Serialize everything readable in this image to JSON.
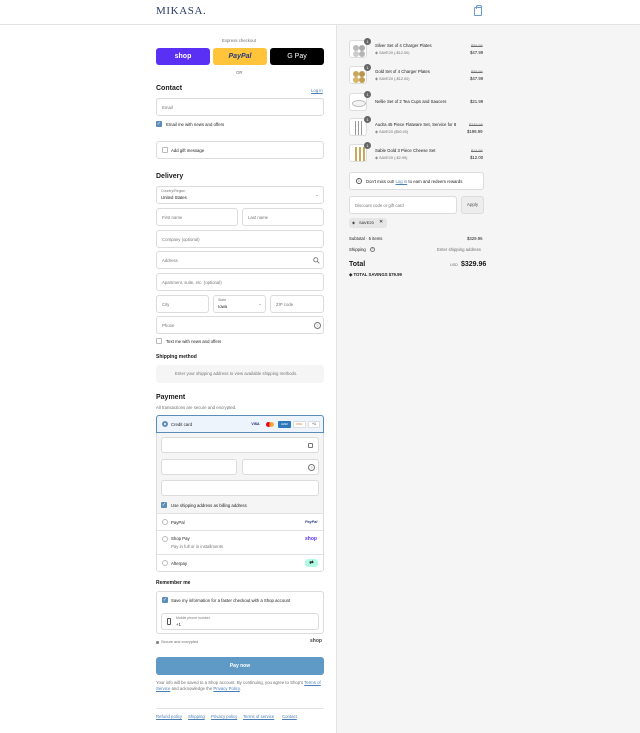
{
  "brand": {
    "logo": "MIKASA."
  },
  "express": {
    "title": "Express checkout",
    "shop": "shop",
    "paypal": "PayPal",
    "gpay": "G Pay",
    "or": "OR"
  },
  "contact": {
    "title": "Contact",
    "login": "Log in",
    "email_ph": "Email",
    "news_label": "Email me with news and offers",
    "gift_label": "Add gift message"
  },
  "delivery": {
    "title": "Delivery",
    "country_label": "Country/Region",
    "country_value": "United States",
    "first_ph": "First name",
    "last_ph": "Last name",
    "company_ph": "Company (optional)",
    "address_ph": "Address",
    "apt_ph": "Apartment, suite, etc. (optional)",
    "city_ph": "City",
    "state_label": "State",
    "state_value": "Iowa",
    "zip_ph": "ZIP code",
    "phone_ph": "Phone",
    "text_label": "Text me with news and offers"
  },
  "shipping": {
    "title": "Shipping method",
    "note": "Enter your shipping address to view available shipping methods."
  },
  "payment": {
    "title": "Payment",
    "subtitle": "All transactions are secure and encrypted.",
    "credit_card": "Credit card",
    "more_cards": "+1",
    "card_brands": [
      "VISA",
      "MC",
      "AMEX",
      "DISC"
    ],
    "billing_label": "Use shipping address as billing address",
    "paypal": "PayPal",
    "paypal_logo": "PayPal",
    "shoppay": "Shop Pay",
    "shoppay_sub": "Pay in full or in installments",
    "shoppay_logo": "shop",
    "afterpay": "Afterpay"
  },
  "remember": {
    "title": "Remember me",
    "save_label": "Save my information for a faster checkout with a Shop account",
    "phone_label": "Mobile phone number",
    "phone_value": "+1",
    "secure": "Secure and encrypted",
    "shop_logo": "shop"
  },
  "pay_button": "Pay now",
  "legal": {
    "text1": "Your info will be saved to a Shop account. By continuing, you agree to Shop's",
    "tos": "Terms of Service",
    "text2": "and acknowledge the",
    "privacy": "Privacy Policy",
    "period": "."
  },
  "footer": [
    "Refund policy",
    "Shipping",
    "Privacy policy",
    "Terms of service",
    "Contact"
  ],
  "items": [
    {
      "name": "Silver Set of 4 Charger Plates",
      "discount": "SAVE20 (-$12.00)",
      "old": "$59.99",
      "price": "$47.99",
      "qty": "1"
    },
    {
      "name": "Gold Set of 4 Charger Plates",
      "discount": "SAVE20 (-$12.00)",
      "old": "$59.99",
      "price": "$47.99",
      "qty": "1"
    },
    {
      "name": "Nellie Set of 2 Tea Cups and Saucers",
      "discount": "",
      "old": "",
      "price": "$21.99",
      "qty": "1"
    },
    {
      "name": "Audra 45 Piece Flatware Set, Service for 8",
      "discount": "SAVE20 ($50.00)",
      "old": "$249.99",
      "price": "$199.99",
      "qty": "1"
    },
    {
      "name": "Sable Gold 3 Piece Cheese Set",
      "discount": "SAVE20 (-$2.99)",
      "old": "$14.99",
      "price": "$12.00",
      "qty": "1"
    }
  ],
  "rewards": {
    "pre": "Don't miss out!",
    "link": "Log in",
    "post": "to earn and redeem rewards"
  },
  "discount": {
    "placeholder": "Discount code or gift card",
    "apply": "Apply",
    "tag": "SAVE20"
  },
  "totals": {
    "subtotal_label": "Subtotal · 5 items",
    "subtotal": "$329.96",
    "shipping_label": "Shipping",
    "shipping_value": "Enter shipping address",
    "total_label": "Total",
    "currency": "USD",
    "total": "$329.96",
    "savings_label": "TOTAL SAVINGS",
    "savings": "$79.99"
  }
}
